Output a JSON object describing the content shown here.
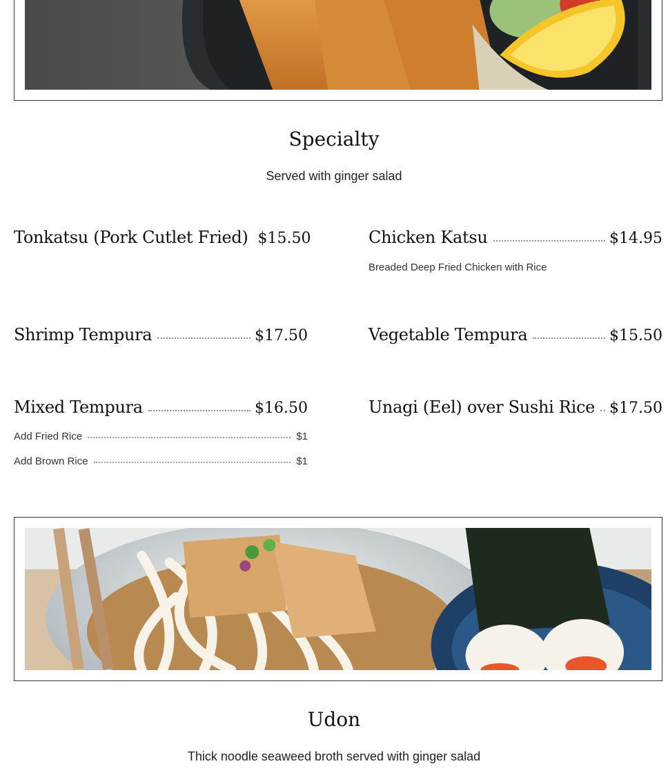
{
  "specialty": {
    "title": "Specialty",
    "subtitle": "Served with ginger salad",
    "items": [
      {
        "name": "Tonkatsu (Pork Cutlet Fried)",
        "price": "$15.50"
      },
      {
        "name": "Chicken Katsu",
        "price": "$14.95",
        "description": "Breaded Deep Fried Chicken with Rice"
      },
      {
        "name": "Shrimp Tempura",
        "price": "$17.50"
      },
      {
        "name": "Vegetable Tempura",
        "price": "$15.50"
      },
      {
        "name": "Mixed Tempura",
        "price": "$16.50"
      },
      {
        "name": "Unagi (Eel) over Sushi Rice",
        "price": "$17.50"
      }
    ],
    "addons": [
      {
        "name": "Add Fried Rice",
        "price": "$1"
      },
      {
        "name": "Add Brown Rice",
        "price": "$1"
      }
    ]
  },
  "udon": {
    "title": "Udon",
    "subtitle": "Thick noodle seaweed broth served with ginger salad"
  }
}
